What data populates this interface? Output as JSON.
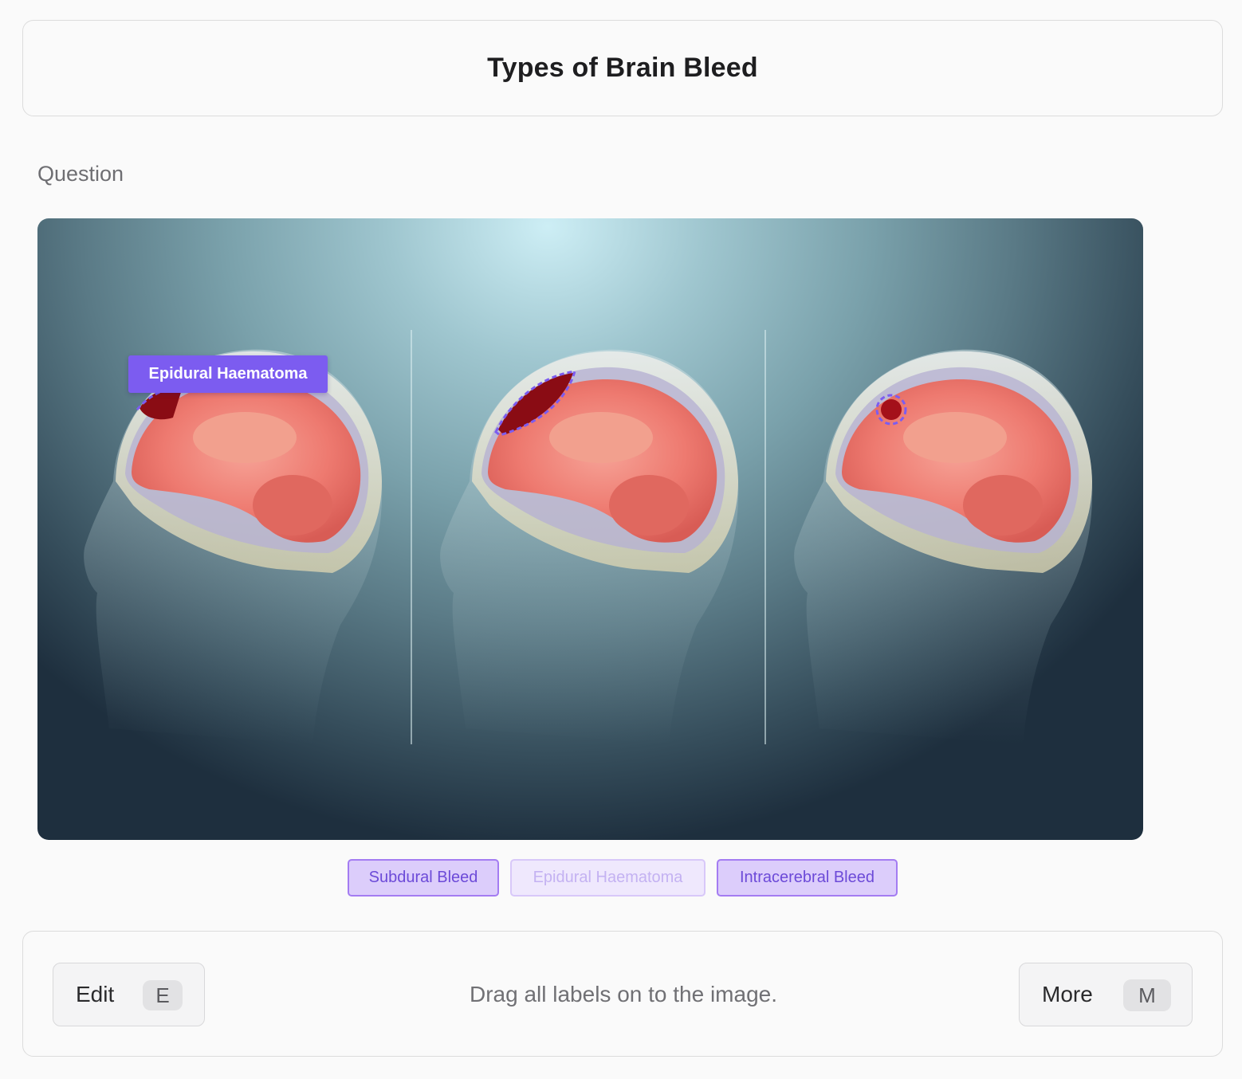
{
  "title": "Types of Brain Bleed",
  "question_label": "Question",
  "placed_label": "Epidural Haematoma",
  "chips": [
    {
      "label": "Subdural Bleed",
      "state": "available"
    },
    {
      "label": "Epidural Haematoma",
      "state": "placed"
    },
    {
      "label": "Intracerebral Bleed",
      "state": "available"
    }
  ],
  "footer": {
    "edit_label": "Edit",
    "edit_key": "E",
    "instruction": "Drag all labels on to the image.",
    "more_label": "More",
    "more_key": "M"
  },
  "colors": {
    "accent": "#7c5cf0",
    "chip_bg": "#dccdfb",
    "chip_border": "#a47cf2",
    "brain": "#ef7b72",
    "bleed": "#9a0a12"
  },
  "image_description_icons": [
    "head-silhouette",
    "brain",
    "bleed-region"
  ]
}
